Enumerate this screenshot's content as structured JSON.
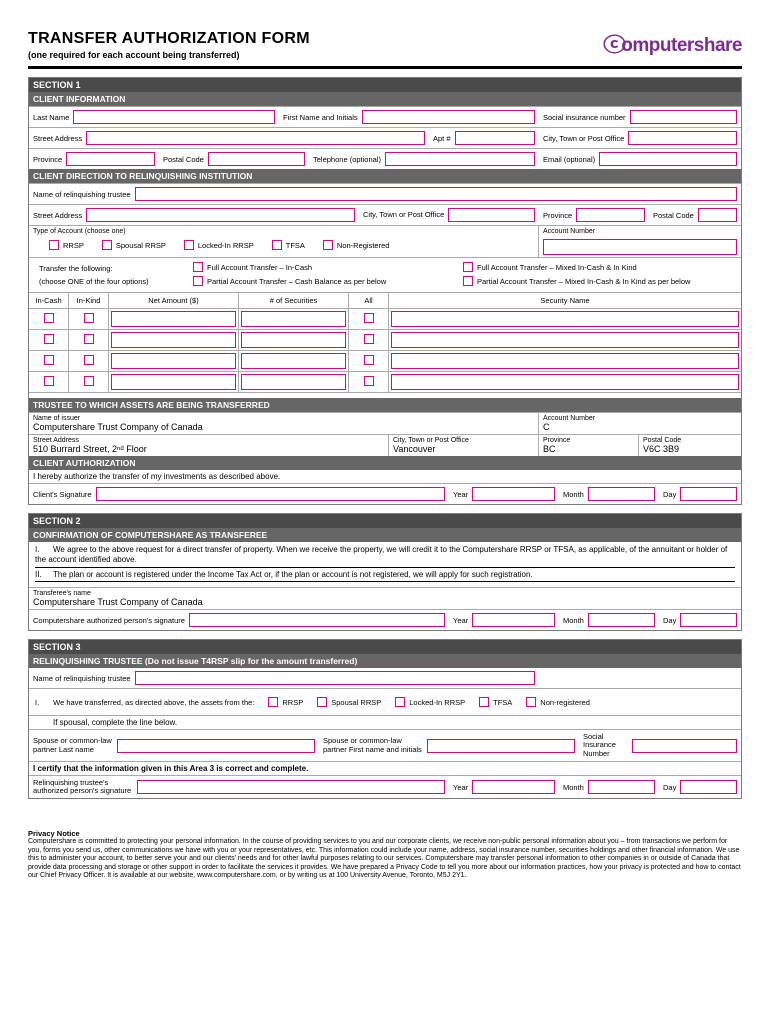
{
  "header": {
    "title": "TRANSFER AUTHORIZATION FORM",
    "subtitle": "(one required for each account being transferred)",
    "logo": "omputershare"
  },
  "section1": {
    "title": "SECTION 1",
    "client_info": "CLIENT INFORMATION",
    "last_name": "Last Name",
    "first_name": "First Name and Initials",
    "sin": "Social insurance number",
    "street": "Street Address",
    "apt": "Apt #",
    "city": "City, Town or Post Office",
    "province": "Province",
    "postal": "Postal Code",
    "phone": "Telephone (optional)",
    "email": "Email (optional)",
    "direction_head": "CLIENT DIRECTION TO RELINQUISHING INSTITUTION",
    "trustee_name": "Name of relinquishing trustee",
    "city2": "City, Town or Post Office",
    "account_type": "Type of Account (choose one)",
    "account_number": "Account Number",
    "ac_rrsp": "RRSP",
    "ac_spousal": "Spousal RRSP",
    "ac_locked": "Locked-In RRSP",
    "ac_tfsa": "TFSA",
    "ac_nonreg": "Non-Registered",
    "transfer_label1": "Transfer the following:",
    "transfer_label2": "(choose ONE of the four options)",
    "opt1": "Full Account Transfer – In-Cash",
    "opt2": "Full Account Transfer – Mixed In-Cash & In Kind",
    "opt3": "Partial Account Transfer – Cash Balance as per below",
    "opt4": "Partial Account Transfer – Mixed In-Cash & In Kind as per below",
    "th_incash": "In-Cash",
    "th_inkind": "In-Kind",
    "th_net": "Net Amount ($)",
    "th_sec": "# of Securities",
    "th_all": "All",
    "th_secname": "Security Name",
    "trustee_head": "TRUSTEE TO WHICH ASSETS ARE BEING TRANSFERRED",
    "issuer_label": "Name of issuer",
    "issuer_name": "Computershare Trust Company of Canada",
    "issuer_street_label": "Street Address",
    "issuer_street": "510 Burrard Street, 2ⁿᵈ Floor",
    "issuer_city_label": "City, Town or Post Office",
    "issuer_city": "Vancouver",
    "issuer_acct_label": "Account Number",
    "issuer_acct_prefix": "C",
    "issuer_prov_label": "Province",
    "issuer_prov": "BC",
    "issuer_postal_label": "Postal Code",
    "issuer_postal": "V6C 3B9",
    "auth_head": "CLIENT AUTHORIZATION",
    "auth_text": "I hereby authorize the transfer of my investments as described above.",
    "client_sig": "Client's Signature",
    "year": "Year",
    "month": "Month",
    "day": "Day"
  },
  "section2": {
    "title": "SECTION 2",
    "sub": "CONFIRMATION OF COMPUTERSHARE AS TRANSFEREE",
    "item1": "We agree to the above request for a direct transfer of property. When we receive the property, we will credit it to the Computershare RRSP or TFSA, as applicable, of the annuitant or holder of the account identified above.",
    "item2": "The plan or account is registered under the Income Tax Act or, if the plan or account is not registered, we will apply for such registration.",
    "transferee_label": "Transferee's name",
    "transferee_name": "Computershare Trust Company of Canada",
    "sig_label": "Computershare authorized person's signature",
    "year": "Year",
    "month": "Month",
    "day": "Day"
  },
  "section3": {
    "title": "SECTION 3",
    "sub": "RELINQUISHING TRUSTEE (Do not issue T4RSP slip for the amount transferred)",
    "name_label": "Name of relinquishing trustee",
    "transfer_text": "We have transferred, as directed above, the assets from the:",
    "rrsp": "RRSP",
    "spousal": "Spousal RRSP",
    "locked": "Locked-In RRSP",
    "tfsa": "TFSA",
    "nonreg": "Non-registered",
    "spousal_note": "If spousal, complete the line below.",
    "spouse_last_label": "Spouse or common-law partner Last name",
    "spouse_first_label": "Spouse or common-law partner First name and initials",
    "spouse_sin_label": "Social Insurance Number",
    "certify": "I certify that the information given in this Area 3 is correct and complete.",
    "sig_label": "Relinquishing trustee's authorized person's signature",
    "year": "Year",
    "month": "Month",
    "day": "Day"
  },
  "privacy": {
    "title": "Privacy Notice",
    "body": "Computershare is committed to protecting your personal information. In the course of providing services to you and our corporate clients, we receive non-public personal information about you – from transactions we perform for you, forms you send us, other communications we have with you or your representatives, etc. This information could include your name, address, social insurance number, securities holdings and other financial information. We use this to administer your account, to better serve your and our clients' needs and for other lawful purposes relating to our services. Computershare may transfer personal information to other companies in or outside of Canada that provide data processing and storage or other support in order to facilitate the services it provides. We have prepared a Privacy Code to tell you more about our information practices, how your privacy is protected and how to contact our Chief Privacy Officer. It is available at our website, www.computershare.com, or by writing us at 100 University Avenue, Toronto, M5J 2Y1."
  }
}
